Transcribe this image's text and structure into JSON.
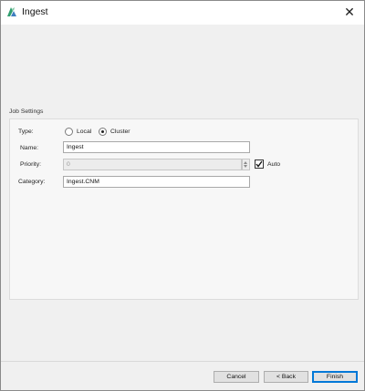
{
  "window": {
    "title": "Ingest",
    "app_icon": "ingest-app-icon",
    "close_icon": "close-icon"
  },
  "job_settings": {
    "section_title": "Job Settings",
    "type": {
      "label": "Type:",
      "options": [
        {
          "label": "Local",
          "selected": false
        },
        {
          "label": "Cluster",
          "selected": true
        }
      ]
    },
    "name": {
      "label": "Name:",
      "value": "Ingest"
    },
    "priority": {
      "label": "Priority:",
      "value": "0",
      "disabled": true,
      "auto_label": "Auto",
      "auto_checked": true
    },
    "category": {
      "label": "Category:",
      "value": "Ingest.CNM"
    }
  },
  "footer": {
    "cancel_label": "Cancel",
    "back_label": "< Back",
    "finish_label": "Finish"
  },
  "colors": {
    "window_bg": "#f0f0f0",
    "accent": "#0078d7",
    "logo_green": "#2f9e6e",
    "logo_blue": "#3f7fbf"
  }
}
